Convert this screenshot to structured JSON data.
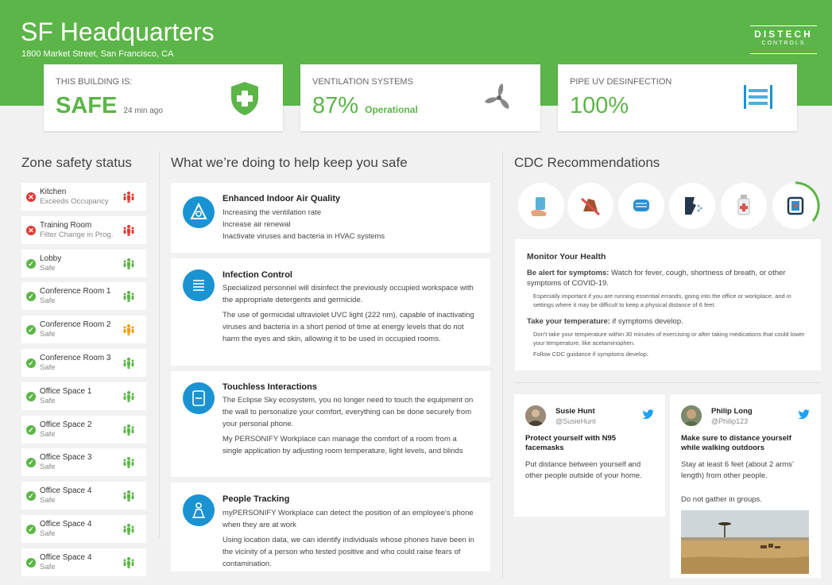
{
  "header": {
    "title": "SF Headquarters",
    "address": "1800 Market Street, San Francisco, CA",
    "logo_line1": "DISTECH",
    "logo_line2": "CONTROLS"
  },
  "cards": {
    "building": {
      "label": "THIS BUILDING IS:",
      "value": "SAFE",
      "sub": "24 min ago",
      "icon": "shield-plus-icon"
    },
    "ventilation": {
      "label": "VENTILATION SYSTEMS",
      "value": "87%",
      "sub": "Operational",
      "icon": "fan-icon"
    },
    "uv": {
      "label": "PIPE UV DESINFECTION",
      "value": "100%",
      "icon": "uv-lamp-icon"
    }
  },
  "zones": {
    "title": "Zone safety status",
    "items": [
      {
        "name": "Kitchen",
        "status": "Exceeds Occupancy",
        "state": "alert"
      },
      {
        "name": "Training Room",
        "status": "Filter Change in Prog.",
        "state": "alert"
      },
      {
        "name": "Lobby",
        "status": "Safe",
        "state": "ok"
      },
      {
        "name": "Conference Room 1",
        "status": "Safe",
        "state": "ok"
      },
      {
        "name": "Conference Room 2",
        "status": "Safe",
        "state": "warn"
      },
      {
        "name": "Conference Room 3",
        "status": "Safe",
        "state": "ok"
      },
      {
        "name": "Office Space 1",
        "status": "Safe",
        "state": "ok"
      },
      {
        "name": "Office Space 2",
        "status": "Safe",
        "state": "ok"
      },
      {
        "name": "Office Space 3",
        "status": "Safe",
        "state": "ok"
      },
      {
        "name": "Office Space 4",
        "status": "Safe",
        "state": "ok"
      },
      {
        "name": "Office Space 4",
        "status": "Safe",
        "state": "ok"
      },
      {
        "name": "Office Space 4",
        "status": "Safe",
        "state": "ok"
      }
    ]
  },
  "help": {
    "title": "What we’re doing to help keep you safe",
    "items": [
      {
        "title": "Enhanced Indoor Air Quality",
        "icon": "air-quality-icon",
        "paragraphs": [
          "Increasing the ventilation rate",
          "Increase air renewal",
          "Inactivate viruses and bacteria in HVAC systems"
        ]
      },
      {
        "title": "Infection Control",
        "icon": "infection-control-icon",
        "paragraphs": [
          "Specialized personnel will disinfect the previously occupied workspace with the appropriate detergents and germicide.",
          "The  use of germicidal ultraviolet UVC light (222 nm), capable of inactivating viruses and bacteria in a short period of time at energy levels that do not harm the eyes and skin, allowing it to be used in occupied rooms."
        ]
      },
      {
        "title": "Touchless Interactions",
        "icon": "touchless-icon",
        "paragraphs": [
          "The Eclipse Sky ecosystem, you no longer need to touch the equipment on the wall to personalize your comfort, everything can be done securely from your personal phone.",
          "My PERSONIFY Workplace can manage the comfort of a room from a single application by adjusting room temperature, light levels, and blinds"
        ]
      },
      {
        "title": "People Tracking",
        "icon": "people-tracking-icon",
        "paragraphs": [
          "myPERSONIFY Workplace can detect the position of an employee's phone when they are at work",
          "Using location data, we can identify individuals whose phones have been in the vicinity of a person who tested positive and who could raise fears of contamination."
        ]
      }
    ]
  },
  "cdc": {
    "title": "CDC Recommendations",
    "icons": [
      "hand-wash-icon",
      "no-touch-face-icon",
      "face-mask-icon",
      "cough-icon",
      "sanitizer-icon",
      "monitor-health-icon"
    ],
    "active_index": 5,
    "panel": {
      "heading": "Monitor Your Health",
      "alert_bold": "Be alert for symptoms:",
      "alert_text": " Watch for fever, cough, shortness of breath, or other symptoms of COVID-19.",
      "alert_note": "Especially important if you are running essential errands, going into  the office or workplace, and in settings where it may be difficult to keep a physical distance of 6 feet.",
      "temp_bold": "Take your temperature:",
      "temp_text": " if symptoms develop.",
      "temp_note": "Don't take your temperature within 30 minutes of exercising or after taking medications that could lower your temperature, like acetaminophen.",
      "follow": "Follow CDC guidance if symptoms develop."
    }
  },
  "tweets": [
    {
      "name": "Susie Hunt",
      "handle": "@SusieHunt",
      "headline": "Protect yourself with N95 facemasks",
      "body": [
        "Put distance between yourself and other people outside of your home."
      ]
    },
    {
      "name": "Philip Long",
      "handle": "@Philip123",
      "headline": "Make sure to distance yourself while walking outdoors",
      "body": [
        "Stay at least 6 feet (about 2 arms’ length) from other people.",
        "Do not gather in groups."
      ],
      "image": "savanna-photo"
    }
  ],
  "colors": {
    "green": "#5cb548",
    "blue": "#1a93d3",
    "red": "#e53935",
    "orange": "#f39c12",
    "twitter": "#1da1f2"
  }
}
